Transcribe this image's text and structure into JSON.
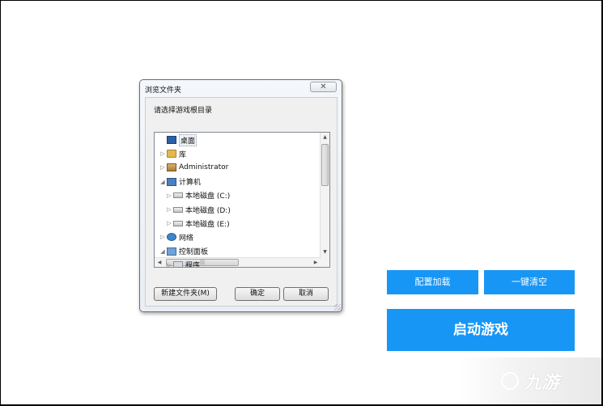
{
  "dialog": {
    "title": "浏览文件夹",
    "close_label": "✕",
    "prompt": "请选择游戏根目录",
    "tree": [
      {
        "label": "桌面",
        "icon": "desktop-icon",
        "arrow": "",
        "indent": 0,
        "selected": true
      },
      {
        "label": "库",
        "icon": "library-icon",
        "arrow": "▷",
        "indent": 0
      },
      {
        "label": "Administrator",
        "icon": "user-folder-icon",
        "arrow": "▷",
        "indent": 0
      },
      {
        "label": "计算机",
        "icon": "computer-icon",
        "arrow": "◢",
        "indent": 0
      },
      {
        "label": "本地磁盘 (C:)",
        "icon": "drive-icon",
        "arrow": "▷",
        "indent": 1
      },
      {
        "label": "本地磁盘 (D:)",
        "icon": "drive-icon",
        "arrow": "▷",
        "indent": 1
      },
      {
        "label": "本地磁盘 (E:)",
        "icon": "drive-icon",
        "arrow": "▷",
        "indent": 1
      },
      {
        "label": "网络",
        "icon": "network-icon",
        "arrow": "▷",
        "indent": 0
      },
      {
        "label": "控制面板",
        "icon": "control-panel-icon",
        "arrow": "◢",
        "indent": 0
      },
      {
        "label": "程序",
        "icon": "program-icon",
        "arrow": "▷",
        "indent": 1
      }
    ],
    "new_folder_label": "新建文件夹(M)",
    "ok_label": "确定",
    "cancel_label": "取消"
  },
  "app": {
    "config_label": "配置加载",
    "clear_label": "一键清空",
    "start_label": "启动游戏",
    "accent_color": "#1796f6"
  },
  "watermark": {
    "text": "九游"
  }
}
